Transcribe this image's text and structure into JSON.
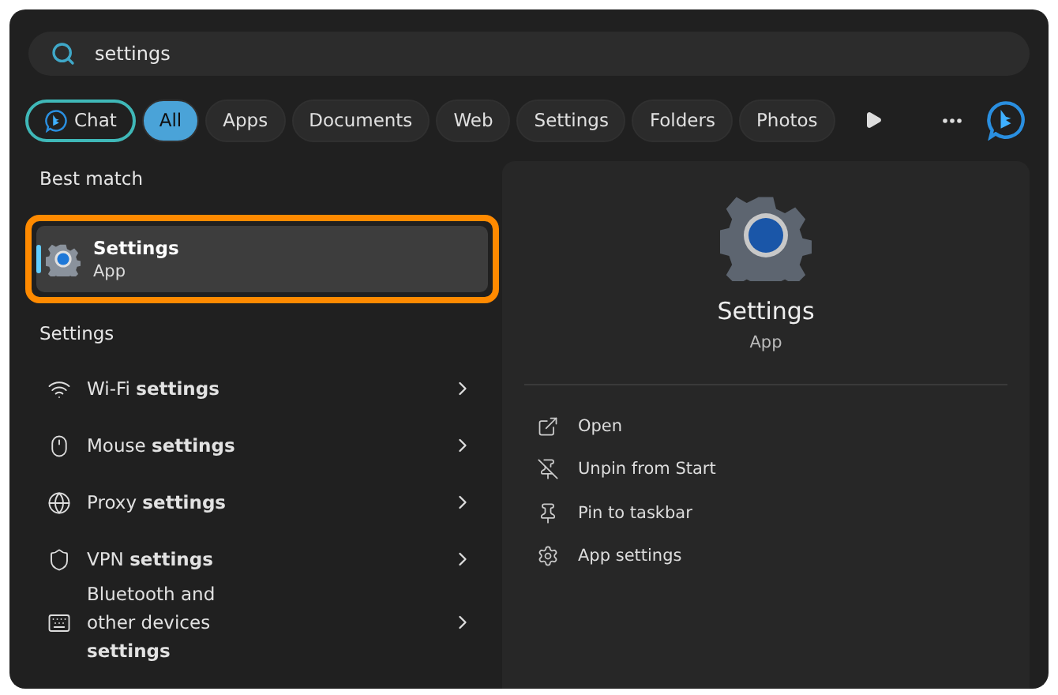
{
  "search": {
    "value": "settings"
  },
  "filters": [
    {
      "kind": "chat",
      "label": "Chat",
      "selected": false
    },
    {
      "kind": "chip",
      "label": "All",
      "selected": true
    },
    {
      "kind": "chip",
      "label": "Apps",
      "selected": false
    },
    {
      "kind": "chip",
      "label": "Documents",
      "selected": false
    },
    {
      "kind": "chip",
      "label": "Web",
      "selected": false
    },
    {
      "kind": "chip",
      "label": "Settings",
      "selected": false
    },
    {
      "kind": "chip",
      "label": "Folders",
      "selected": false
    },
    {
      "kind": "chip",
      "label": "Photos",
      "selected": false
    }
  ],
  "best_match": {
    "heading": "Best match",
    "title": "Settings",
    "subtitle": "App",
    "selected": true,
    "highlighted": true
  },
  "settings_section": {
    "heading": "Settings",
    "items": [
      {
        "kind": "wifi",
        "label": "Wi-Fi **settings**"
      },
      {
        "kind": "mouse",
        "label": "Mouse **settings**"
      },
      {
        "kind": "globe",
        "label": "Proxy **settings**"
      },
      {
        "kind": "shield",
        "label": "VPN **settings**"
      },
      {
        "kind": "devices",
        "label": "Bluetooth and other devices **settings**"
      }
    ]
  },
  "preview": {
    "title": "Settings",
    "subtitle": "App",
    "actions": [
      {
        "kind": "open",
        "label": "Open"
      },
      {
        "kind": "unpin",
        "label": "Unpin from Start"
      },
      {
        "kind": "pin",
        "label": "Pin to taskbar"
      },
      {
        "kind": "gear",
        "label": "App settings"
      }
    ]
  }
}
